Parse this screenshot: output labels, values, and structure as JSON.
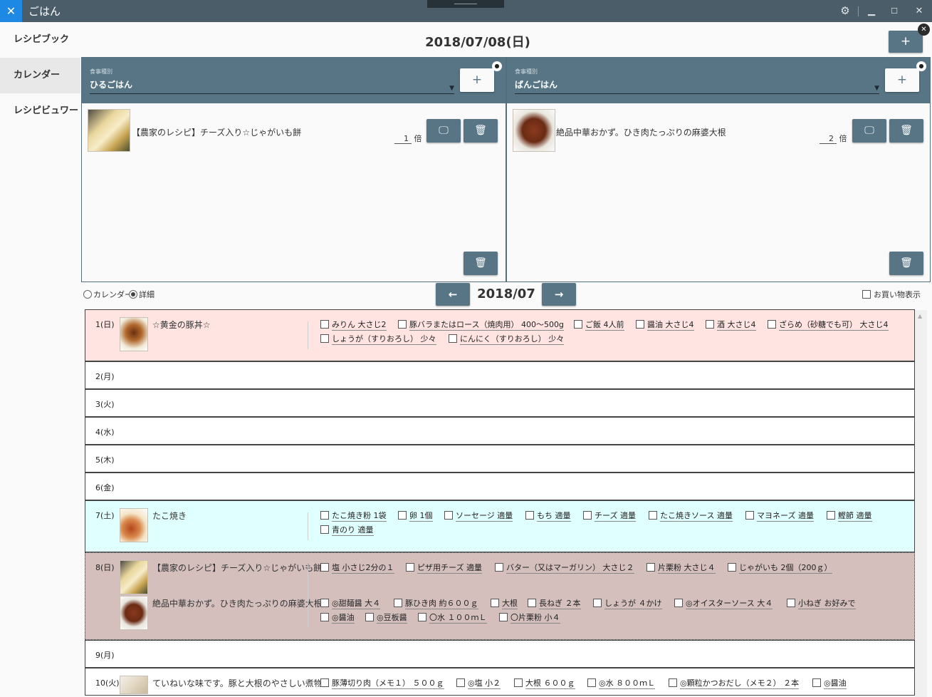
{
  "window": {
    "title": "ごはん",
    "app_icon": "utensils-icon",
    "controls": [
      "gear-icon",
      "minimize-icon",
      "maximize-icon",
      "close-icon"
    ]
  },
  "sidebar": {
    "items": [
      {
        "label": "レシピブック",
        "active": false
      },
      {
        "label": "カレンダー",
        "active": true
      },
      {
        "label": "レシピビュワー",
        "active": false
      }
    ]
  },
  "day_view": {
    "date": "2018/07/08(日)",
    "add_button": "+",
    "panels": [
      {
        "meal_label": "食事種別",
        "meal_value": "ひるごはん",
        "add_button": "+",
        "recipe": {
          "name": "【農家のレシピ】チーズ入り☆じゃがいも餅",
          "servings": "1",
          "unit": "倍"
        }
      },
      {
        "meal_label": "食事種別",
        "meal_value": "ばんごはん",
        "add_button": "+",
        "recipe": {
          "name": "絶品中華おかず。ひき肉たっぷりの麻婆大根",
          "servings": "2",
          "unit": "倍"
        }
      }
    ]
  },
  "month_view": {
    "mode_calendar": "カレンダー",
    "mode_detail": "詳細",
    "selected_mode": "詳細",
    "month": "2018/07",
    "prev": "←",
    "next": "→",
    "shopping_toggle": "お買い物表示",
    "days": [
      {
        "label": "1(日)",
        "color": "#ffe4e1",
        "recipes": [
          "☆黄金の豚丼☆"
        ],
        "ingredients": [
          [
            "みりん 大さじ2",
            "豚バラまたはロース（焼肉用） 400～500g",
            "ご飯 4人前",
            "醤油 大さじ4",
            "酒 大さじ4",
            "ざらめ（砂糖でも可） 大さじ4"
          ],
          [
            "しょうが（すりおろし） 少々",
            "にんにく（すりおろし） 少々"
          ]
        ]
      },
      {
        "label": "2(月)",
        "color": "#ffffff",
        "recipes": [],
        "ingredients": []
      },
      {
        "label": "3(火)",
        "color": "#ffffff",
        "recipes": [],
        "ingredients": []
      },
      {
        "label": "4(水)",
        "color": "#ffffff",
        "recipes": [],
        "ingredients": []
      },
      {
        "label": "5(木)",
        "color": "#ffffff",
        "recipes": [],
        "ingredients": []
      },
      {
        "label": "6(金)",
        "color": "#ffffff",
        "recipes": [],
        "ingredients": []
      },
      {
        "label": "7(土)",
        "color": "#e0ffff",
        "recipes": [
          "たこ焼き"
        ],
        "ingredients": [
          [
            "たこ焼き粉 1袋",
            "卵 1個",
            "ソーセージ 適量",
            "もち 適量",
            "チーズ 適量",
            "たこ焼きソース 適量",
            "マヨネーズ 適量",
            "鰹節 適量"
          ],
          [
            "青のり 適量"
          ]
        ]
      },
      {
        "label": "8(日)",
        "color": "#d4bfbd",
        "recipes": [
          "【農家のレシピ】チーズ入り☆じゃがいも餅",
          "絶品中華おかず。ひき肉たっぷりの麻婆大根"
        ],
        "ingredients": [
          [
            "塩 小さじ2分の１",
            "ピザ用チーズ 適量",
            "バター（又はマーガリン） 大さじ２",
            "片栗粉 大さじ４",
            "じゃがいも 2個（200ｇ）"
          ],
          [
            "◎甜麺醤 大４",
            "豚ひき肉 約６００ｇ",
            "大根",
            "長ねぎ ２本",
            "しょうが ４かけ",
            "◎オイスターソース 大４",
            "小ねぎ お好みで"
          ],
          [
            "◎醤油",
            "◎豆板醤",
            "〇水 １００ｍＬ",
            "〇片栗粉 小４"
          ]
        ]
      },
      {
        "label": "9(月)",
        "color": "#ffffff",
        "recipes": [],
        "ingredients": []
      },
      {
        "label": "10(火)",
        "color": "#ffffff",
        "recipes": [
          "ていねいな味です。豚と大根のやさしい煮物"
        ],
        "ingredients": [
          [
            "豚薄切り肉（メモ１） ５００ｇ",
            "◎塩 小２",
            "大根 ６００ｇ",
            "◎水 ８００ｍＬ",
            "◎顆粒かつおだし（メモ２） ２本",
            "◎醤油"
          ]
        ]
      }
    ]
  }
}
